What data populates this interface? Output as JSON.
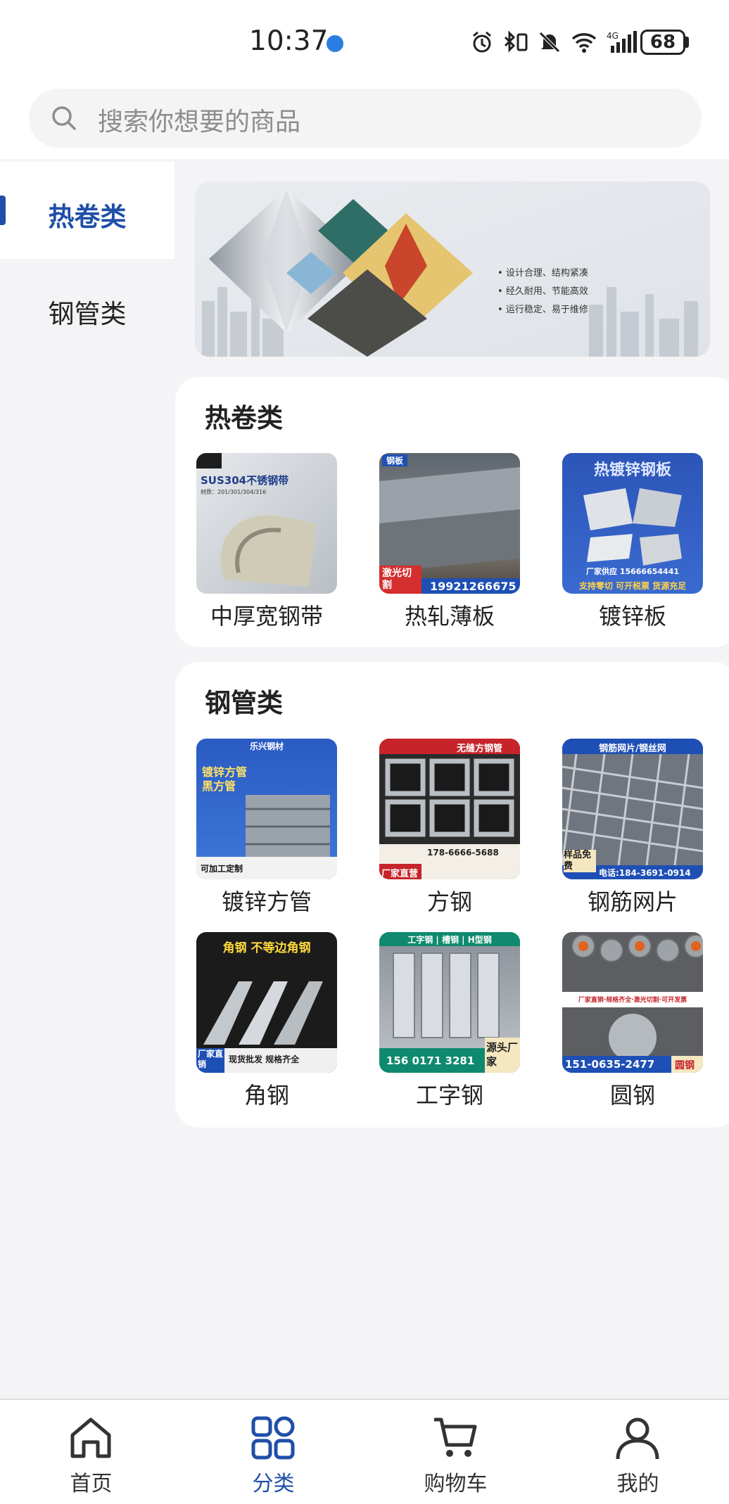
{
  "status_bar": {
    "time": "10:37",
    "battery": "68"
  },
  "search": {
    "placeholder": "搜索你想要的商品"
  },
  "sidebar": {
    "items": [
      {
        "label": "热卷类",
        "active": true
      },
      {
        "label": "钢管类",
        "active": false
      }
    ]
  },
  "banner": {
    "points": [
      "设计合理、结构紧凑",
      "经久耐用、节能高效",
      "运行稳定、易于维修"
    ]
  },
  "sections": [
    {
      "title": "热卷类",
      "products": [
        {
          "name": "中厚宽钢带",
          "img_text": [
            "SUS304不锈钢带",
            "材质：201/301/304/316"
          ]
        },
        {
          "name": "热轧薄板",
          "img_text": [
            "钢板",
            "激光切割",
            "19921266675"
          ]
        },
        {
          "name": "镀锌板",
          "img_text": [
            "热镀锌钢板",
            "厂家供应 15666654441",
            "支持零切 可开税票 货源充足"
          ]
        }
      ]
    },
    {
      "title": "钢管类",
      "products": [
        {
          "name": "镀锌方管",
          "img_text": [
            "乐兴钢材",
            "镀锌方管",
            "黑方管",
            "可加工定制"
          ]
        },
        {
          "name": "方钢",
          "img_text": [
            "无缝方钢管",
            "178-6666-5688",
            "厂家直营"
          ]
        },
        {
          "name": "钢筋网片",
          "img_text": [
            "钢筋网片/钢丝网",
            "样品免费",
            "电话:184-3691-0914"
          ]
        },
        {
          "name": "角钢",
          "img_text": [
            "角钢 不等边角钢",
            "厂家直销",
            "现货批发 规格齐全"
          ]
        },
        {
          "name": "工字钢",
          "img_text": [
            "工字钢 | 槽钢 | H型钢",
            "156 0171 3281",
            "源头厂家"
          ]
        },
        {
          "name": "圆钢",
          "img_text": [
            "厂家直销·规格齐全·激光切割·可开发票",
            "151-0635-2477",
            "圆钢"
          ]
        }
      ]
    }
  ],
  "tabbar": {
    "items": [
      {
        "label": "首页",
        "icon": "home-icon",
        "active": false
      },
      {
        "label": "分类",
        "icon": "category-icon",
        "active": true
      },
      {
        "label": "购物车",
        "icon": "cart-icon",
        "active": false
      },
      {
        "label": "我的",
        "icon": "user-icon",
        "active": false
      }
    ]
  },
  "colors": {
    "accent": "#1f4fa8",
    "background": "#f4f4f6"
  }
}
